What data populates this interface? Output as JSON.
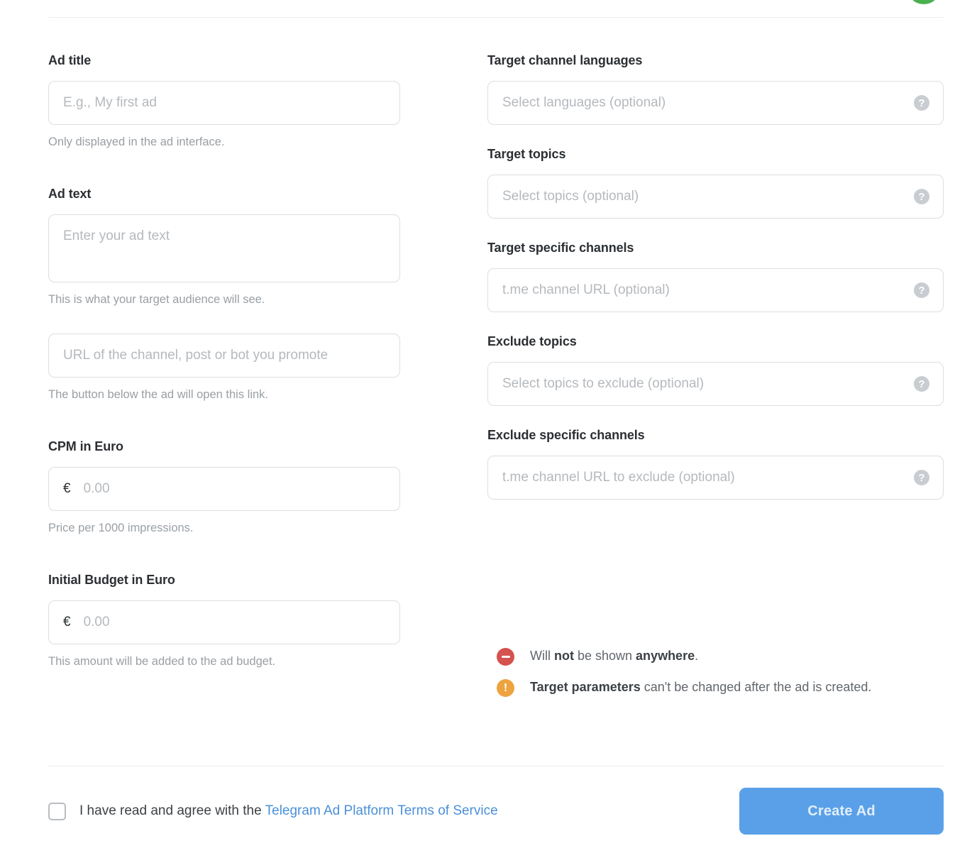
{
  "header": {
    "status_dot_color": "#4caf50"
  },
  "left_column": {
    "ad_title": {
      "label": "Ad title",
      "placeholder": "E.g., My first ad",
      "hint": "Only displayed in the ad interface."
    },
    "ad_text": {
      "label": "Ad text",
      "placeholder": "Enter your ad text",
      "hint": "This is what your target audience will see."
    },
    "ad_url": {
      "placeholder": "URL of the channel, post or bot you promote",
      "hint": "The button below the ad will open this link."
    },
    "cpm": {
      "label": "CPM in Euro",
      "currency": "€",
      "placeholder": "0.00",
      "hint": "Price per 1000 impressions."
    },
    "budget": {
      "label": "Initial Budget in Euro",
      "currency": "€",
      "placeholder": "0.00",
      "hint": "This amount will be added to the ad budget."
    }
  },
  "right_column": {
    "target_languages": {
      "label": "Target channel languages",
      "placeholder": "Select languages (optional)",
      "help": "?"
    },
    "target_topics": {
      "label": "Target topics",
      "placeholder": "Select topics (optional)",
      "help": "?"
    },
    "target_channels": {
      "label": "Target specific channels",
      "placeholder": "t.me channel URL (optional)",
      "help": "?"
    },
    "exclude_topics": {
      "label": "Exclude topics",
      "placeholder": "Select topics to exclude (optional)",
      "help": "?"
    },
    "exclude_channels": {
      "label": "Exclude specific channels",
      "placeholder": "t.me channel URL to exclude (optional)",
      "help": "?"
    }
  },
  "notes": [
    {
      "icon": "minus-circle-icon",
      "color": "#d4524f",
      "prefix": "Will ",
      "bold1": "not",
      "middle": " be shown ",
      "bold2": "anywhere",
      "suffix": "."
    },
    {
      "icon": "exclamation-circle-icon",
      "color": "#eda33f",
      "prefix": "",
      "bold1": "Target parameters",
      "middle": " can't be changed after the ad is created.",
      "bold2": "",
      "suffix": ""
    }
  ],
  "footer": {
    "agree_text": "I have read and agree with the ",
    "tos_link": "Telegram Ad Platform Terms of Service",
    "create_button": "Create Ad",
    "button_color": "#5aa0e8",
    "checkbox_checked": false
  }
}
